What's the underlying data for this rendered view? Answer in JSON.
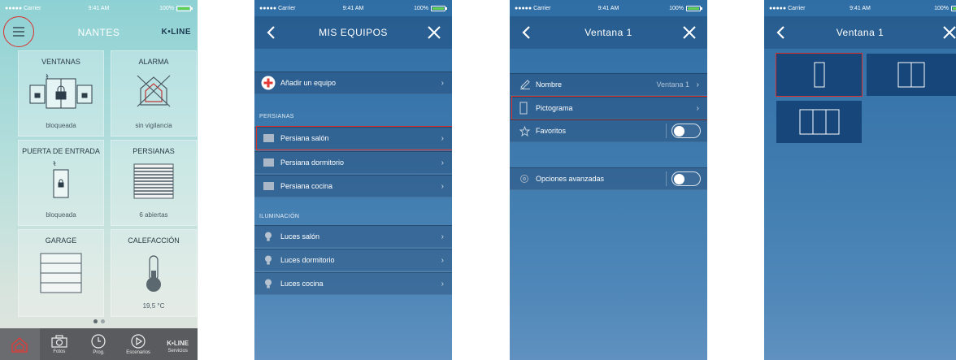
{
  "status_bar": {
    "carrier": "●●●●● Carrier",
    "time": "9:41 AM",
    "battery": "100%"
  },
  "screen_home": {
    "title": "NANTES",
    "brand": "K•LINE",
    "tiles": [
      {
        "label": "VENTANAS",
        "status": "bloqueada",
        "icon": "window-lock-icon"
      },
      {
        "label": "ALARMA",
        "status": "sin vigilancia",
        "icon": "alarm-house-icon"
      },
      {
        "label": "PUERTA DE ENTRADA",
        "status": "bloqueada",
        "icon": "door-lock-icon"
      },
      {
        "label": "PERSIANAS",
        "status": "6 abiertas",
        "icon": "shutter-icon"
      },
      {
        "label": "GARAGE",
        "status": "",
        "icon": "garage-door-icon"
      },
      {
        "label": "CALEFACCIÓN",
        "status": "19,5 °C",
        "icon": "thermometer-icon"
      }
    ],
    "page_dots": {
      "count": 2,
      "active": 0
    },
    "tabs": [
      {
        "label": "",
        "icon": "home-icon"
      },
      {
        "label": "Fotos",
        "icon": "camera-icon"
      },
      {
        "label": "Prog.",
        "icon": "clock-icon"
      },
      {
        "label": "Escenarios",
        "icon": "play-icon"
      },
      {
        "label": "Servicios",
        "icon": "kline-logo-icon",
        "logo": "K•LINE"
      }
    ]
  },
  "screen_equipos": {
    "title": "MIS EQUIPOS",
    "add_label": "Añadir un equipo",
    "section_persianas": "PERSIANAS",
    "persianas": [
      "Persiana salón",
      "Persiana dormitorio",
      "Persiana cocina"
    ],
    "section_iluminacion": "ILUMINACIÓN",
    "luces": [
      "Luces salón",
      "Luces dormitorio",
      "Luces cocina"
    ]
  },
  "screen_ventana": {
    "title": "Ventana 1",
    "nombre_label": "Nombre",
    "nombre_value": "Ventana 1",
    "pictograma_label": "Pictograma",
    "favoritos_label": "Favoritos",
    "opciones_label": "Opciones avanzadas"
  },
  "screen_pictograma": {
    "title": "Ventana 1",
    "options": [
      "single-pane-window-icon",
      "double-pane-window-icon",
      "triple-pane-window-icon"
    ],
    "selected": 0
  },
  "colors": {
    "highlight": "#d9302c",
    "accent_red": "#e53935",
    "battery": "#62d14f"
  }
}
